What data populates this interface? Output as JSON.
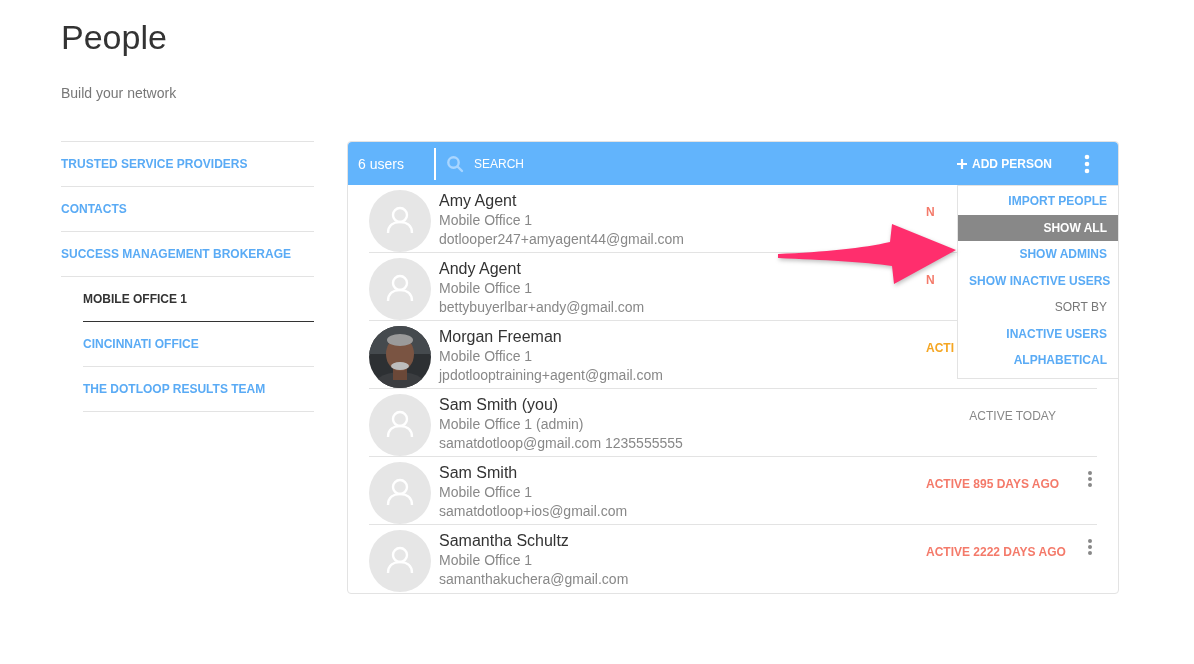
{
  "page": {
    "title": "People",
    "subtitle": "Build your network"
  },
  "sidebar": {
    "items": [
      {
        "label": "TRUSTED SERVICE PROVIDERS",
        "selected": false
      },
      {
        "label": "CONTACTS",
        "selected": false
      },
      {
        "label": "SUCCESS MANAGEMENT BROKERAGE",
        "selected": false,
        "children": [
          {
            "label": "MOBILE OFFICE 1",
            "selected": true
          },
          {
            "label": "CINCINNATI OFFICE",
            "selected": false
          },
          {
            "label": "THE DOTLOOP RESULTS TEAM",
            "selected": false
          }
        ]
      }
    ]
  },
  "toolbar": {
    "count": "6 users",
    "search": {
      "placeholder": "SEARCH"
    },
    "add_button": "ADD PERSON"
  },
  "menu": {
    "items": [
      {
        "kind": "item",
        "label": "IMPORT PEOPLE",
        "selected": false
      },
      {
        "kind": "item",
        "label": "SHOW ALL",
        "selected": true
      },
      {
        "kind": "item",
        "label": "SHOW ADMINS",
        "selected": false
      },
      {
        "kind": "item",
        "label": "SHOW INACTIVE USERS",
        "selected": false
      },
      {
        "kind": "heading",
        "label": "SORT BY"
      },
      {
        "kind": "item",
        "label": "INACTIVE USERS",
        "selected": false
      },
      {
        "kind": "item",
        "label": "ALPHABETICAL",
        "selected": false
      }
    ]
  },
  "people": [
    {
      "name": "Amy Agent",
      "office": "Mobile Office 1",
      "contact": "dotlooper247+amyagent44@gmail.com",
      "photo": false,
      "status": "N",
      "status_bold": true,
      "status_covered": true,
      "color": "#f47a6a",
      "row_menu": false
    },
    {
      "name": "Andy Agent",
      "office": "Mobile Office 1",
      "contact": "bettybuyerlbar+andy@gmail.com",
      "photo": false,
      "status": "N",
      "status_bold": true,
      "status_covered": true,
      "color": "#f47a6a",
      "row_menu": false
    },
    {
      "name": "Morgan Freeman",
      "office": "Mobile Office 1",
      "contact": "jpdotlooptraining+agent@gmail.com",
      "photo": true,
      "status": "ACTI",
      "status_bold": true,
      "status_covered": true,
      "color": "#f5a623",
      "row_menu": false
    },
    {
      "name": "Sam Smith (you)",
      "office": "Mobile Office 1 (admin)",
      "contact": "samatdotloop@gmail.com 1235555555",
      "photo": false,
      "status": "ACTIVE TODAY",
      "status_bold": false,
      "status_covered": false,
      "color": "#888888",
      "row_menu": false
    },
    {
      "name": "Sam Smith",
      "office": "Mobile Office 1",
      "contact": "samatdotloop+ios@gmail.com",
      "photo": false,
      "status": "ACTIVE 895 DAYS AGO",
      "status_bold": true,
      "status_covered": false,
      "color": "#f47a6a",
      "row_menu": true
    },
    {
      "name": "Samantha Schultz",
      "office": "Mobile Office 1",
      "contact": "samanthakuchera@gmail.com",
      "photo": false,
      "status": "ACTIVE 2222 DAYS AGO",
      "status_bold": true,
      "status_covered": false,
      "color": "#f47a6a",
      "row_menu": true
    }
  ]
}
